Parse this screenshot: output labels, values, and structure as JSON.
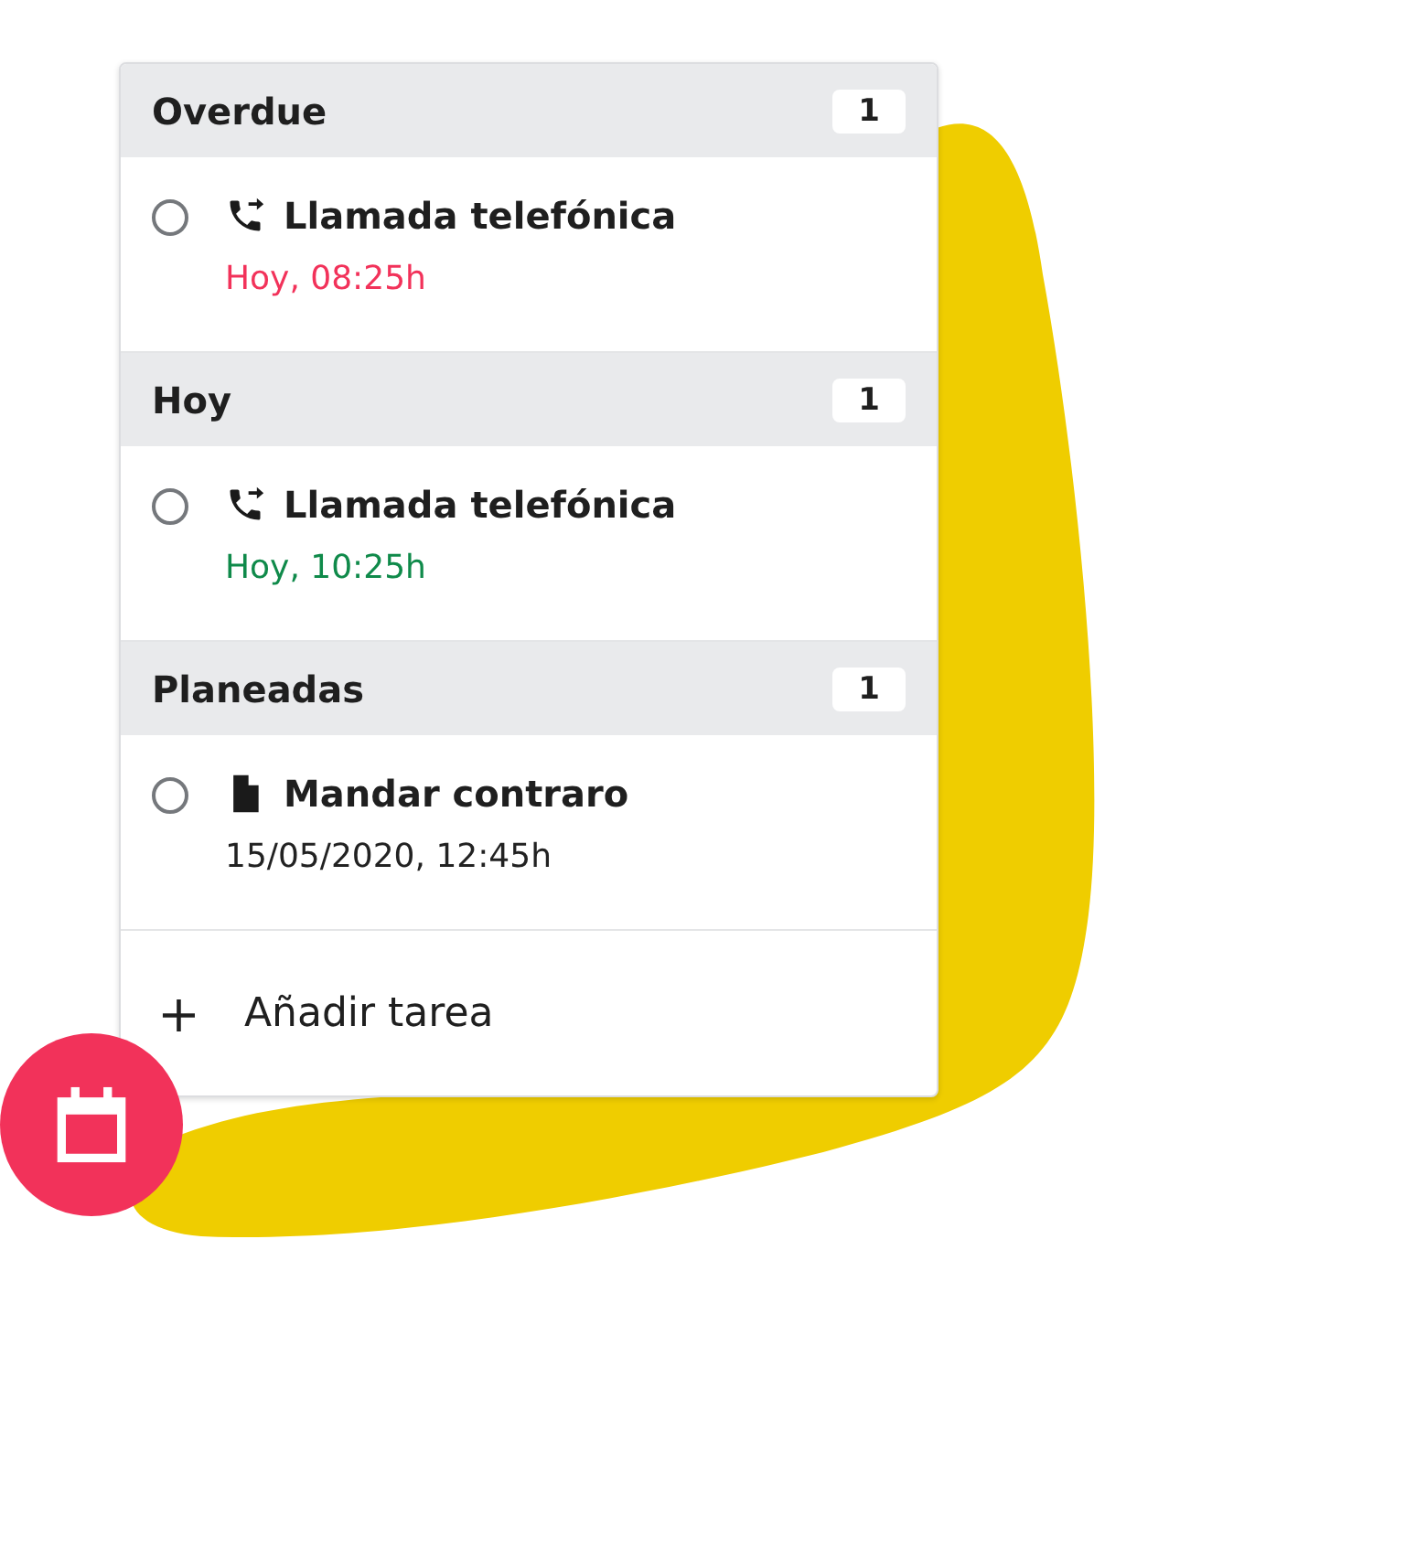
{
  "sections": [
    {
      "title": "Overdue",
      "count": "1",
      "tasks": [
        {
          "kind": "call",
          "title": "Llamada telefónica",
          "due": "Hoy, 08:25h",
          "color": "#f2325a",
          "checked": false
        }
      ]
    },
    {
      "title": "Hoy",
      "count": "1",
      "tasks": [
        {
          "kind": "call",
          "title": "Llamada telefónica",
          "due": "Hoy, 10:25h",
          "color": "#0f8a4a",
          "checked": false
        }
      ]
    },
    {
      "title": "Planeadas",
      "count": "1",
      "tasks": [
        {
          "kind": "document",
          "title": "Mandar contraro",
          "due": "15/05/2020, 12:45h",
          "color": "#222222",
          "checked": false
        }
      ]
    }
  ],
  "add_task": {
    "icon": "+",
    "label": "Añadir tarea"
  }
}
